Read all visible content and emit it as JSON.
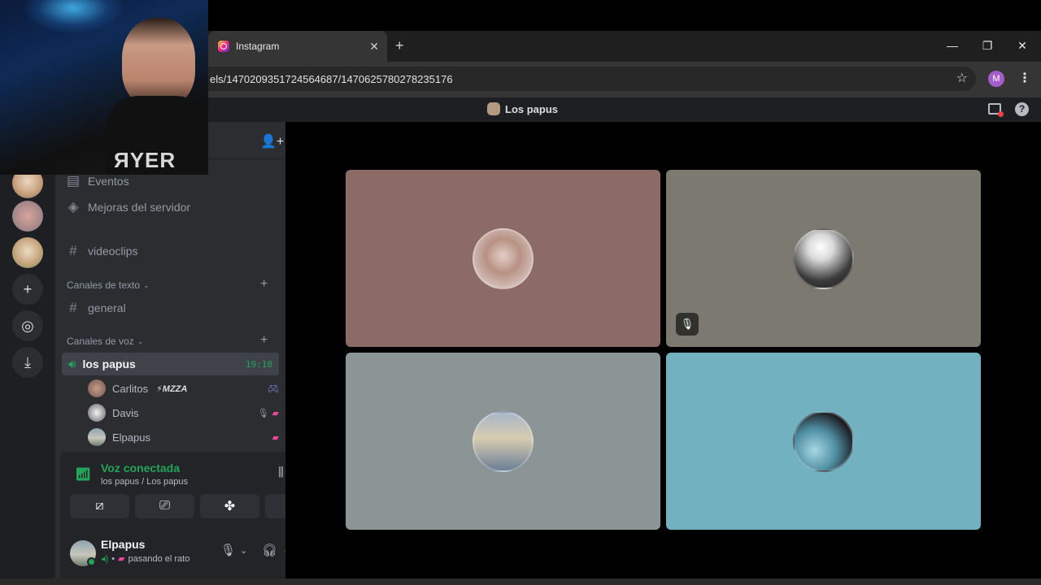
{
  "browser": {
    "tab_title": "Instagram",
    "tab_close": "✕",
    "new_tab": "+",
    "url": "els/1470209351724564687/1470625780278235176",
    "profile_initial": "M"
  },
  "titlebar": {
    "server_name": "Los papus"
  },
  "channels": {
    "events": "Eventos",
    "boosts": "Mejoras del servidor",
    "videoclips": "videoclips",
    "text_category": "Canales de texto",
    "general": "general",
    "voice_category": "Canales de voz",
    "voice_channel": "los papus",
    "voice_timer": "19:10"
  },
  "voice_users": [
    {
      "name": "Carlitos",
      "tag": "⚡MZZA"
    },
    {
      "name": "Davis",
      "tag": ""
    },
    {
      "name": "Elpapus",
      "tag": ""
    }
  ],
  "voice_panel": {
    "title": "Voz conectada",
    "subtitle": "los papus / Los papus"
  },
  "user_panel": {
    "name": "Elpapus",
    "status": "pasando el rato"
  },
  "webcam": {
    "shirt_text": "ЯYER"
  },
  "colors": {
    "tile1": "#8c6a65",
    "tile2": "#7c7a70",
    "tile3": "#8b9596",
    "tile4": "#72b2c0",
    "voice_green": "#23a55a"
  }
}
